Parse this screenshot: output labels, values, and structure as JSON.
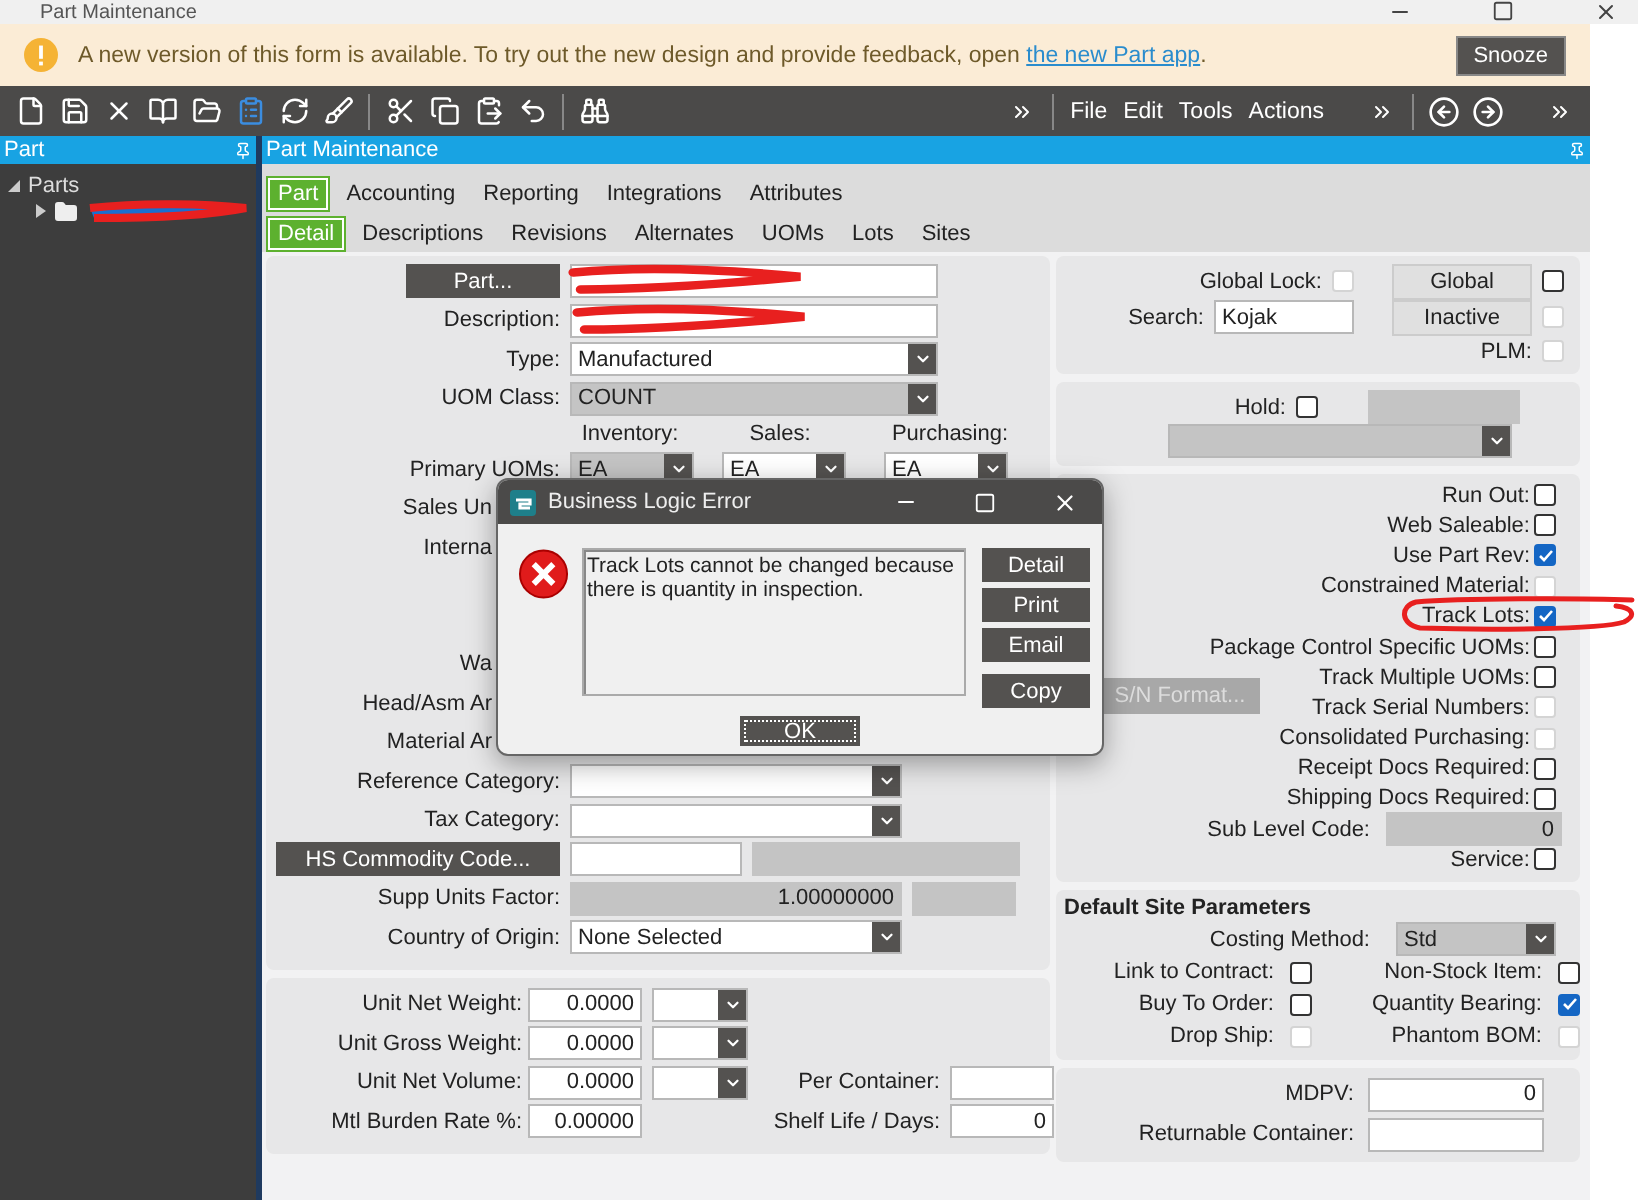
{
  "window": {
    "title": "Part Maintenance"
  },
  "notice": {
    "text": "A new version of this form is available. To try out the new design and provide feedback, open ",
    "link": "the new Part app",
    "end": ".",
    "button": "Snooze"
  },
  "menus": [
    "File",
    "Edit",
    "Tools",
    "Actions"
  ],
  "tree": {
    "title": "Part",
    "items": [
      {
        "label": "Parts",
        "expanded": true,
        "children": [
          {
            "redacted": true
          }
        ]
      }
    ]
  },
  "form": {
    "title": "Part Maintenance",
    "tabs": [
      {
        "label": "Part",
        "selected": true
      },
      {
        "label": "Accounting",
        "selected": false
      },
      {
        "label": "Reporting",
        "selected": false
      },
      {
        "label": "Integrations",
        "selected": false
      },
      {
        "label": "Attributes",
        "selected": false
      }
    ],
    "subtabs": [
      {
        "label": "Detail",
        "selected": true
      },
      {
        "label": "Descriptions",
        "selected": false
      },
      {
        "label": "Revisions",
        "selected": false
      },
      {
        "label": "Alternates",
        "selected": false
      },
      {
        "label": "UOMs",
        "selected": false
      },
      {
        "label": "Lots",
        "selected": false
      },
      {
        "label": "Sites",
        "selected": false
      }
    ],
    "upper": [
      {
        "kind": "lookup",
        "button": "Part...",
        "redacted": true
      },
      {
        "kind": "text",
        "label": "Description:",
        "redacted": true
      },
      {
        "kind": "dropdown",
        "label": "Type:",
        "value": "Manufactured",
        "disabled": false
      },
      {
        "kind": "dropdown",
        "label": "UOM Class:",
        "value": "COUNT",
        "disabled": true
      },
      {
        "kind": "headings",
        "items": [
          "Inventory:",
          "Sales:",
          "Purchasing:"
        ]
      },
      {
        "kind": "uoms",
        "label": "Primary UOMs:",
        "values": [
          "EA",
          "EA",
          "EA"
        ]
      },
      {
        "kind": "covered",
        "label": "Sales Un"
      },
      {
        "kind": "covered",
        "label": "Interna"
      }
    ],
    "lower": [
      {
        "kind": "covered",
        "label": "Wa"
      },
      {
        "kind": "covered",
        "label": "Head/Asm Ar"
      },
      {
        "kind": "covered",
        "label": "Material Ar"
      },
      {
        "kind": "dropdown",
        "label": "Reference Category:"
      },
      {
        "kind": "dropdown",
        "label": "Tax Category:"
      },
      {
        "kind": "lookup",
        "button": "HS Commodity Code..."
      },
      {
        "kind": "number",
        "label": "Supp Units Factor:",
        "value": "1.00000000"
      },
      {
        "kind": "dropdown",
        "label": "Country of Origin:",
        "value": "None Selected"
      }
    ],
    "weights": {
      "left": [
        {
          "label": "Unit Net Weight:",
          "value": "0.0000",
          "unit": true
        },
        {
          "label": "Unit Gross Weight:",
          "value": "0.0000",
          "unit": true
        },
        {
          "label": "Unit Net Volume:",
          "value": "0.0000",
          "unit": true
        },
        {
          "label": "Mtl Burden Rate %:",
          "value": "0.00000",
          "unit": false
        }
      ],
      "right": [
        {
          "label": "Per Container:"
        },
        {
          "label": "Shelf Life / Days:",
          "value": "0"
        }
      ]
    },
    "general": {
      "global_lock": {
        "label": "Global Lock:",
        "checked": false,
        "disabled": true
      },
      "search": {
        "label": "Search:",
        "value": "Kojak"
      },
      "global": {
        "button": "Global",
        "checked": false,
        "disabled": false
      },
      "inactive": {
        "button": "Inactive",
        "checked": false,
        "disabled": true
      },
      "plm": {
        "label": "PLM:",
        "checked": false,
        "disabled": true
      }
    },
    "hold": {
      "label": "Hold:",
      "checked": false,
      "disabled": false
    },
    "options": [
      {
        "kind": "check",
        "label": "Run Out:",
        "checked": false,
        "disabled": false
      },
      {
        "kind": "check",
        "label": "Web Saleable:",
        "checked": false,
        "disabled": false
      },
      {
        "kind": "check",
        "label": "Use Part Rev:",
        "checked": true,
        "disabled": false
      },
      {
        "kind": "check",
        "label": "Constrained Material:",
        "checked": false,
        "disabled": true
      },
      {
        "kind": "check",
        "label": "Track Lots:",
        "checked": true,
        "disabled": false
      },
      {
        "kind": "check",
        "label": "Package Control Specific UOMs:",
        "checked": false,
        "disabled": false
      },
      {
        "kind": "check",
        "label": "Track Multiple UOMs:",
        "checked": false,
        "disabled": false
      },
      {
        "kind": "check",
        "label": "Track Serial Numbers:",
        "checked": false,
        "disabled": true,
        "button": {
          "label": "S/N Format...",
          "disabled": true
        }
      },
      {
        "kind": "check",
        "label": "Consolidated Purchasing:",
        "checked": false,
        "disabled": true
      },
      {
        "kind": "check",
        "label": "Receipt Docs Required:",
        "checked": false,
        "disabled": false
      },
      {
        "kind": "check",
        "label": "Shipping Docs Required:",
        "checked": false,
        "disabled": false
      },
      {
        "kind": "field",
        "label": "Sub Level Code:",
        "value": "0"
      },
      {
        "kind": "check",
        "label": "Service:",
        "checked": false,
        "disabled": false
      }
    ],
    "site": {
      "title": "Default Site Parameters",
      "costing": {
        "label": "Costing Method:",
        "value": "Std"
      },
      "checks": [
        {
          "label": "Link to Contract:",
          "checked": false,
          "disabled": false
        },
        {
          "label": "Non-Stock Item:",
          "checked": false,
          "disabled": false
        },
        {
          "label": "Buy To Order:",
          "checked": false,
          "disabled": false
        },
        {
          "label": "Quantity Bearing:",
          "checked": true,
          "disabled": false
        },
        {
          "label": "Drop Ship:",
          "checked": false,
          "disabled": true
        },
        {
          "label": "Phantom BOM:",
          "checked": false,
          "disabled": true
        }
      ]
    },
    "extra": [
      {
        "label": "MDPV:",
        "value": "0"
      },
      {
        "label": "Returnable Container:"
      }
    ]
  },
  "dialog": {
    "title": "Business Logic Error",
    "message": "Track Lots cannot be changed because there is quantity in inspection.",
    "buttons": [
      "Detail",
      "Print",
      "Email",
      "Copy"
    ],
    "ok": "OK"
  }
}
